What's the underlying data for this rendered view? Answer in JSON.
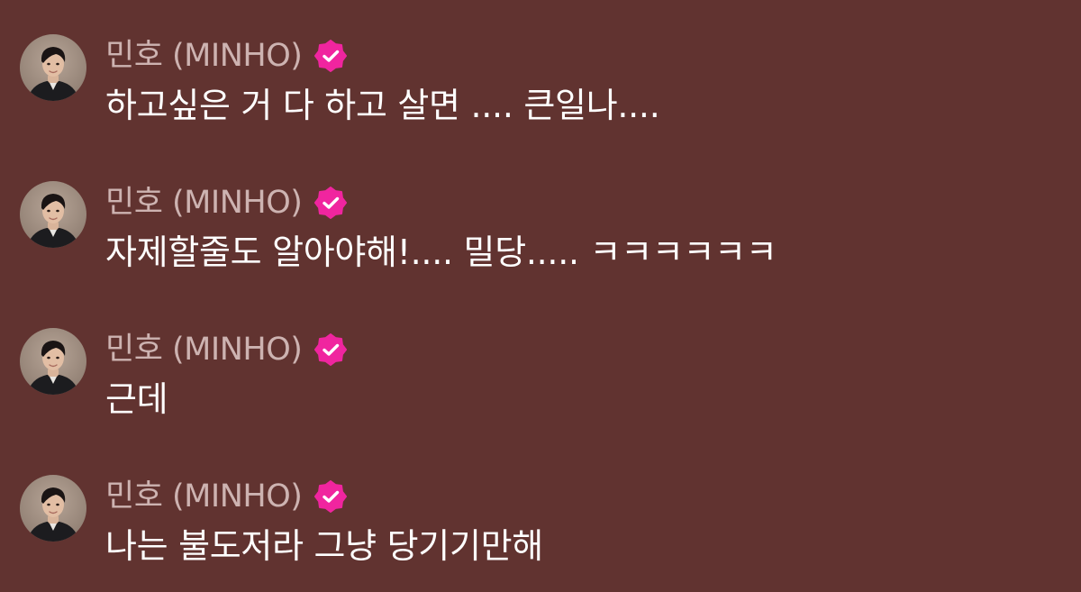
{
  "theme": {
    "background": "#613330",
    "name_color": "#cdb3b1",
    "text_color": "#ffffff",
    "verified_color": "#f0259f",
    "avatar_bg": "#8b7a6e"
  },
  "icons": {
    "avatar": "profile-photo",
    "verified": "verified-badge-icon"
  },
  "messages": [
    {
      "sender": "민호 (MINHO)",
      "verified": true,
      "text": "하고싶은 거 다 하고 살면 .... 큰일나...."
    },
    {
      "sender": "민호 (MINHO)",
      "verified": true,
      "text": "자제할줄도 알아야해!.... 밀당..... ㅋㅋㅋㅋㅋㅋ"
    },
    {
      "sender": "민호 (MINHO)",
      "verified": true,
      "text": "근데"
    },
    {
      "sender": "민호 (MINHO)",
      "verified": true,
      "text": "나는 불도저라 그냥 당기기만해"
    }
  ]
}
